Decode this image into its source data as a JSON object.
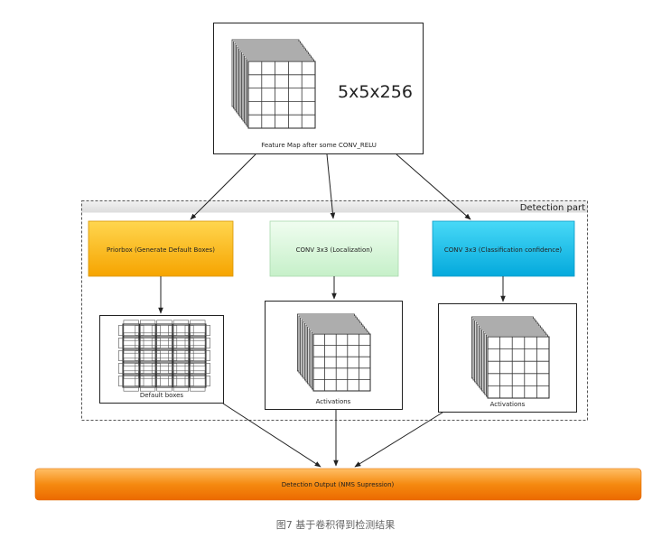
{
  "feature_map": {
    "size_label": "5x5x256",
    "caption": "Feature Map after some CONV_RELU"
  },
  "detection_part": {
    "label": "Detection part"
  },
  "blocks": {
    "priorbox": "Priorbox (Generate Default Boxes)",
    "localization": "CONV 3x3 (Localization)",
    "classification": "CONV 3x3 (Classification confidence)"
  },
  "outputs": {
    "default_boxes": "Default boxes",
    "activations_loc": "Activations",
    "activations_cls": "Activations"
  },
  "detection_output": "Detection Output (NMS Supression)",
  "figure_caption": "图7 基于卷积得到检测结果",
  "colors": {
    "priorbox_top": "#ffd64f",
    "priorbox_bottom": "#f6a400",
    "loc_top": "#ecfbec",
    "loc_bottom": "#c9f2cb",
    "cls_top": "#3fd5f5",
    "cls_bottom": "#08aee0",
    "output_top": "#ffb04a",
    "output_bottom": "#f07700"
  }
}
